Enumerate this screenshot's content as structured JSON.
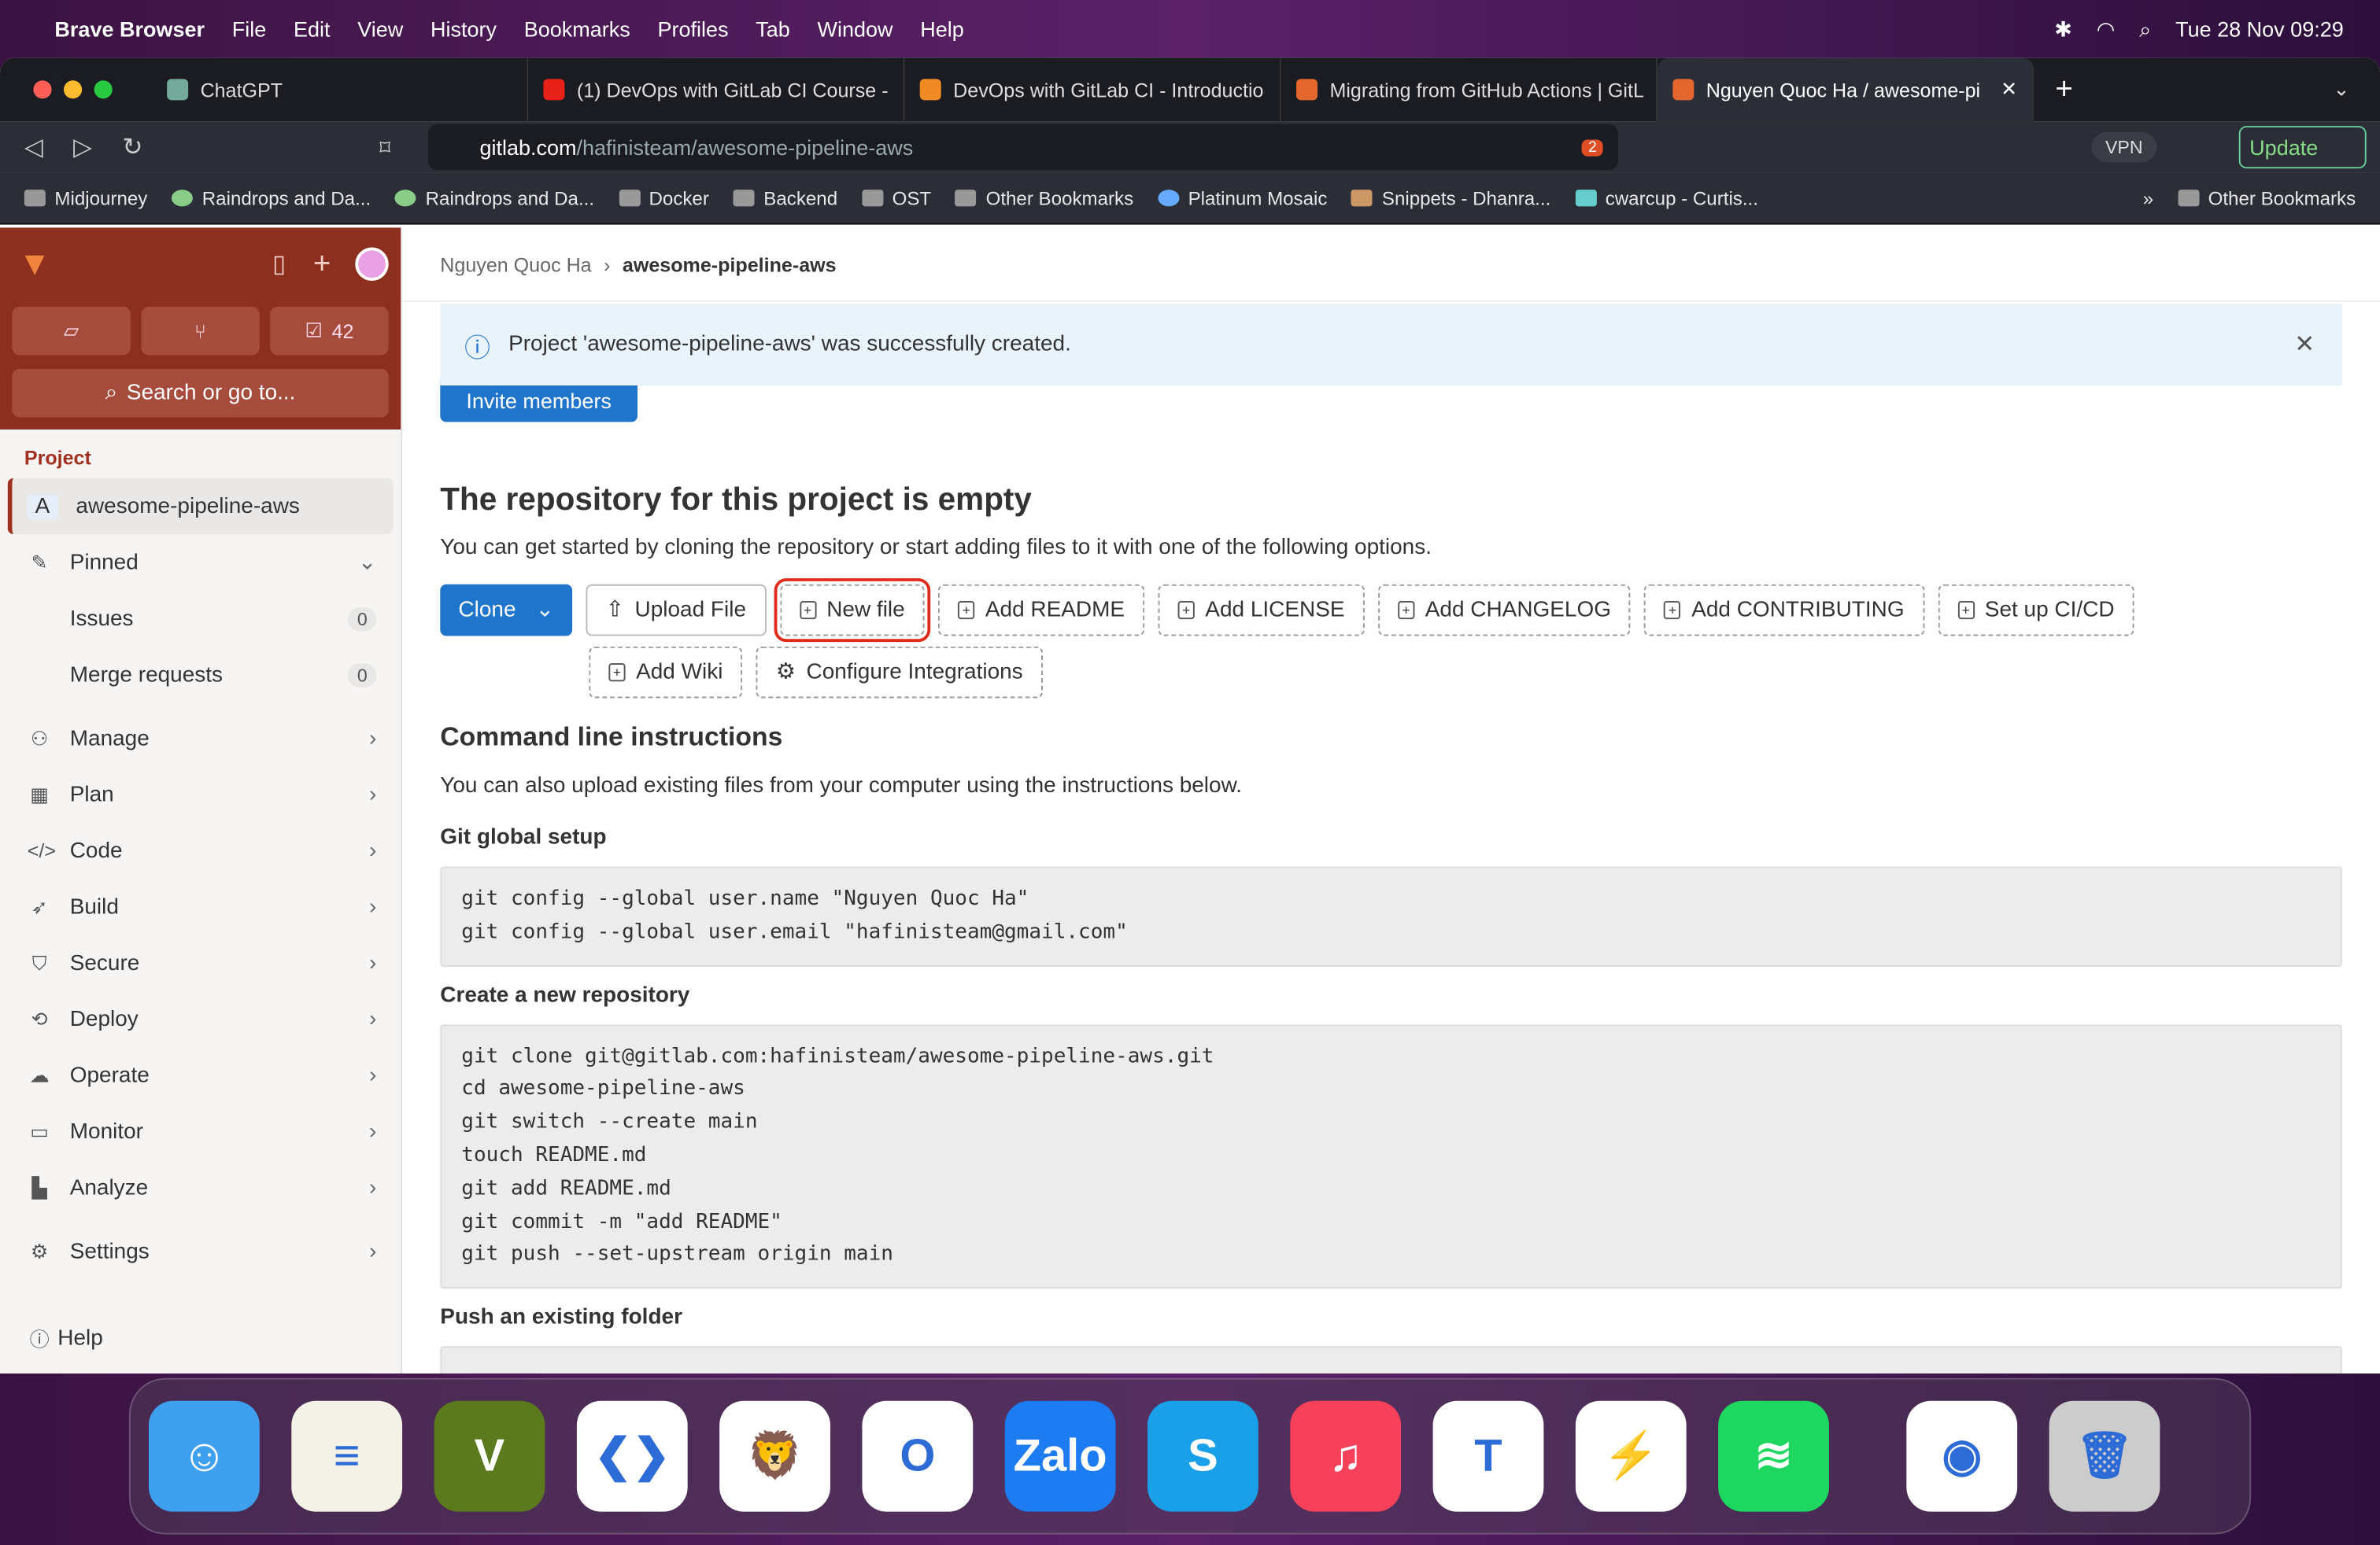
{
  "menubar": {
    "app": "Brave Browser",
    "items": [
      "File",
      "Edit",
      "View",
      "History",
      "Bookmarks",
      "Profiles",
      "Tab",
      "Window",
      "Help"
    ],
    "clock": "Tue 28 Nov  09:29"
  },
  "tabs": [
    {
      "title": "ChatGPT",
      "color": "#74aa9c"
    },
    {
      "title": "(1) DevOps with GitLab CI Course -",
      "color": "#e62117"
    },
    {
      "title": "DevOps with GitLab CI - Introductio",
      "color": "#f08a24"
    },
    {
      "title": "Migrating from GitHub Actions | GitL",
      "color": "#e2662d"
    },
    {
      "title": "Nguyen Quoc Ha / awesome-pi",
      "color": "#e2662d",
      "active": true
    }
  ],
  "toolbar": {
    "url_host": "gitlab.com",
    "url_path": "/hafinisteam/awesome-pipeline-aws",
    "vpn": "VPN",
    "update": "Update",
    "shields_count": "2"
  },
  "bookmarks": [
    "Midjourney",
    "Raindrops and Da...",
    "Raindrops and Da...",
    "Docker",
    "Backend",
    "OST",
    "Other Bookmarks",
    "Platinum Mosaic",
    "Snippets - Dhanra...",
    "cwarcup - Curtis..."
  ],
  "bookmarks_overflow": "»",
  "other_bookmarks": "Other Bookmarks",
  "sidebar": {
    "todo_count": "42",
    "search": "Search or go to...",
    "section": "Project",
    "project_initial": "A",
    "project": "awesome-pipeline-aws",
    "pinned": "Pinned",
    "pinned_items": [
      {
        "label": "Issues",
        "count": "0"
      },
      {
        "label": "Merge requests",
        "count": "0"
      }
    ],
    "items": [
      "Manage",
      "Plan",
      "Code",
      "Build",
      "Secure",
      "Deploy",
      "Operate",
      "Monitor",
      "Analyze"
    ],
    "settings": "Settings",
    "help": "Help"
  },
  "main": {
    "breadcrumb": [
      "Nguyen Quoc Ha",
      "awesome-pipeline-aws"
    ],
    "alert": "Project 'awesome-pipeline-aws' was successfully created.",
    "invite": "Invite members",
    "heading": "The repository for this project is empty",
    "subtext": "You can get started by cloning the repository or start adding files to it with one of the following options.",
    "buttons": {
      "clone": "Clone",
      "upload": "Upload File",
      "new_file": "New file",
      "readme": "Add README",
      "license": "Add LICENSE",
      "changelog": "Add CHANGELOG",
      "contributing": "Add CONTRIBUTING",
      "cicd": "Set up CI/CD",
      "wiki": "Add Wiki",
      "integrations": "Configure Integrations"
    },
    "cli_heading": "Command line instructions",
    "cli_text": "You can also upload existing files from your computer using the instructions below.",
    "global_heading": "Git global setup",
    "global_code": "git config --global user.name \"Nguyen Quoc Ha\"\ngit config --global user.email \"hafinisteam@gmail.com\"",
    "new_repo_heading": "Create a new repository",
    "new_repo_code": "git clone git@gitlab.com:hafinisteam/awesome-pipeline-aws.git\ncd awesome-pipeline-aws\ngit switch --create main\ntouch README.md\ngit add README.md\ngit commit -m \"add README\"\ngit push --set-upstream origin main",
    "push_heading": "Push an existing folder"
  },
  "dock": [
    {
      "name": "Finder",
      "color": "#3fa0f0",
      "glyph": "☺"
    },
    {
      "name": "Notes",
      "color": "#f4f1e6",
      "glyph": "≡"
    },
    {
      "name": "Vim",
      "color": "#5b7a1e",
      "glyph": "V"
    },
    {
      "name": "VS Code",
      "color": "#ffffff",
      "glyph": "❮❯"
    },
    {
      "name": "Brave",
      "color": "#ffffff",
      "glyph": "🦁"
    },
    {
      "name": "Outlook",
      "color": "#ffffff",
      "glyph": "O"
    },
    {
      "name": "Zalo",
      "color": "#1e7cf2",
      "glyph": "Zalo"
    },
    {
      "name": "Skype",
      "color": "#1aa0e8",
      "glyph": "S"
    },
    {
      "name": "Music",
      "color": "#f7405a",
      "glyph": "♫"
    },
    {
      "name": "Teams",
      "color": "#ffffff",
      "glyph": "T"
    },
    {
      "name": "Messenger",
      "color": "#ffffff",
      "glyph": "⚡"
    },
    {
      "name": "Spotify",
      "color": "#1ed760",
      "glyph": "≋"
    },
    {
      "name": "Chrome",
      "color": "#ffffff",
      "glyph": "◉"
    },
    {
      "name": "Trash",
      "color": "#cccccc",
      "glyph": "🗑"
    }
  ]
}
